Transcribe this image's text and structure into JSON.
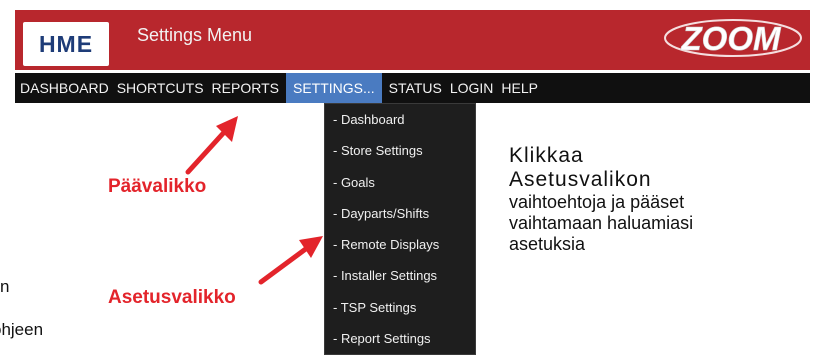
{
  "header": {
    "logo_text": "HME",
    "title": "Settings Menu",
    "brand_logo_text": "ZOOM",
    "color": "#b8272d"
  },
  "nav": {
    "items": [
      {
        "label": "DASHBOARD"
      },
      {
        "label": "SHORTCUTS"
      },
      {
        "label": "REPORTS"
      },
      {
        "label": "SETTINGS..."
      },
      {
        "label": "STATUS"
      },
      {
        "label": "LOGIN"
      },
      {
        "label": "HELP"
      }
    ],
    "active_label": "SETTINGS...",
    "active_color": "#4a7bc1"
  },
  "dropdown": {
    "items": [
      {
        "label": "- Dashboard"
      },
      {
        "label": "- Store Settings"
      },
      {
        "label": "- Goals"
      },
      {
        "label": "- Dayparts/Shifts"
      },
      {
        "label": "- Remote Displays"
      },
      {
        "label": "- Installer Settings"
      },
      {
        "label": "- TSP Settings"
      },
      {
        "label": "- Report Settings"
      }
    ]
  },
  "annotations": {
    "main_menu_label": "Päävalikko",
    "settings_menu_label": "Asetusvalikko",
    "instruction_big_1": "Klikkaa",
    "instruction_big_2": "Asetusvalikon",
    "instruction_small_1": "vaihtoehtoja ja pääset",
    "instruction_small_2": "vaihtamaan haluamiasi",
    "instruction_small_3": "asetuksia",
    "edge_text_1": "n",
    "edge_text_2": "ohjeen",
    "arrow_color": "#e3242b"
  }
}
